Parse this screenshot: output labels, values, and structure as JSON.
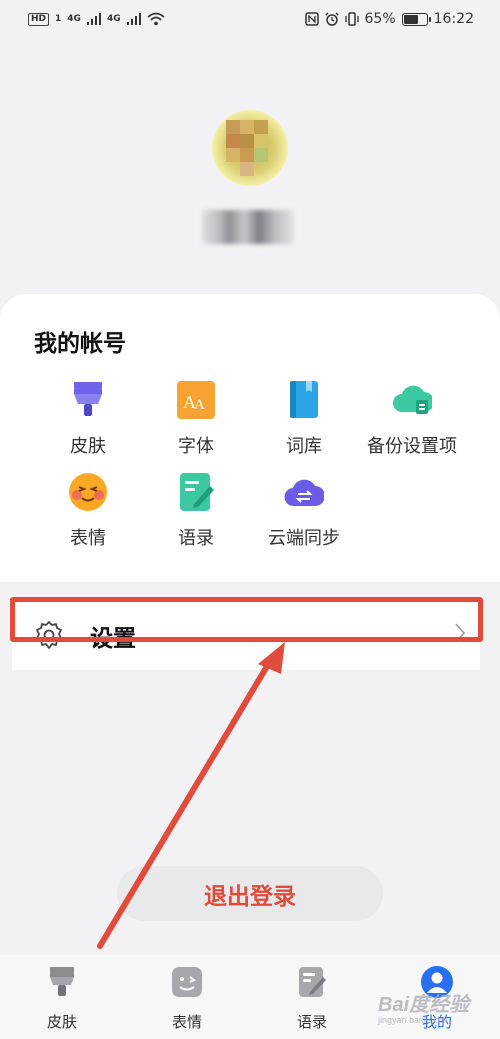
{
  "status_bar": {
    "hd": "HD",
    "sim1": "1",
    "net1": "4G",
    "net2": "4G",
    "battery": "65%",
    "battery_level": 0.65,
    "time": "16:22"
  },
  "account": {
    "title": "我的帐号",
    "items": [
      {
        "label": "皮肤",
        "icon": "skin-brush-icon"
      },
      {
        "label": "字体",
        "icon": "font-icon"
      },
      {
        "label": "词库",
        "icon": "dictionary-book-icon"
      },
      {
        "label": "备份设置项",
        "icon": "cloud-backup-icon"
      },
      {
        "label": "表情",
        "icon": "emoji-icon"
      },
      {
        "label": "语录",
        "icon": "quotes-note-icon"
      },
      {
        "label": "云端同步",
        "icon": "cloud-sync-icon"
      }
    ]
  },
  "settings": {
    "label": "设置",
    "icon": "gear-icon"
  },
  "logout": {
    "label": "退出登录"
  },
  "bottom_nav": {
    "items": [
      {
        "label": "皮肤",
        "icon": "skin-brush-icon"
      },
      {
        "label": "表情",
        "icon": "emoji-icon"
      },
      {
        "label": "语录",
        "icon": "quotes-note-icon"
      },
      {
        "label": "我的",
        "icon": "profile-icon",
        "active": true
      }
    ]
  },
  "watermark": {
    "text": "Bai度经验",
    "sub": "jingyan.baidu.com"
  },
  "colors": {
    "accent": "#2a6ef2",
    "highlight": "#e14b3b",
    "logout_text": "#e14b3b"
  }
}
